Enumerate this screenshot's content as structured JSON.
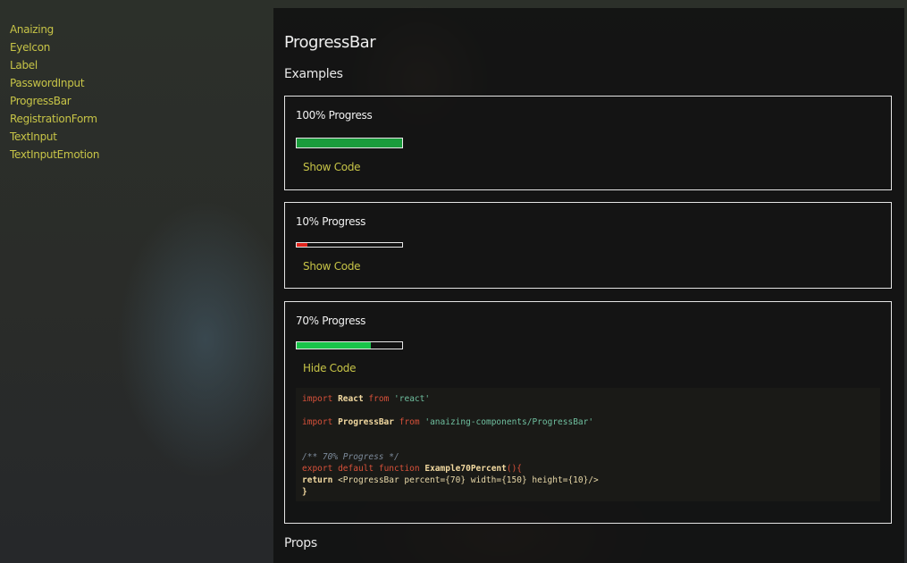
{
  "sidebar": {
    "items": [
      {
        "label": "Anaizing"
      },
      {
        "label": "EyeIcon"
      },
      {
        "label": "Label"
      },
      {
        "label": "PasswordInput"
      },
      {
        "label": "ProgressBar"
      },
      {
        "label": "RegistrationForm"
      },
      {
        "label": "TextInput"
      },
      {
        "label": "TextInputEmotion"
      }
    ]
  },
  "main": {
    "title": "ProgressBar",
    "examples_heading": "Examples",
    "props_heading": "Props",
    "examples": [
      {
        "title": "100% Progress",
        "percent": 100,
        "fill_color": "#1a9c3c",
        "toggle_label": "Show Code"
      },
      {
        "title": "10% Progress",
        "percent": 10,
        "fill_color": "#e0241c",
        "toggle_label": "Show Code"
      },
      {
        "title": "70% Progress",
        "percent": 70,
        "fill_color": "#19c44a",
        "toggle_label": "Hide Code",
        "code": {
          "line1_import": "import",
          "line1_name": "React",
          "line1_from": "from",
          "line1_src": "'react'",
          "line2_import": "import",
          "line2_name": "ProgressBar",
          "line2_from": "from",
          "line2_src": "'anaizing-components/ProgressBar'",
          "comment": "/** 70% Progress */",
          "line4_export": "export",
          "line4_default": "default",
          "line4_function": "function",
          "line4_name": "Example70Percent",
          "line4_paren": "(){",
          "line5_return": "return",
          "line5_jsx": "<ProgressBar percent={70} width={150} height={10}/>",
          "closing": "}"
        }
      }
    ]
  },
  "colors": {
    "accent": "#c7c447",
    "panel": "#111111",
    "border": "#e5e5e5"
  }
}
